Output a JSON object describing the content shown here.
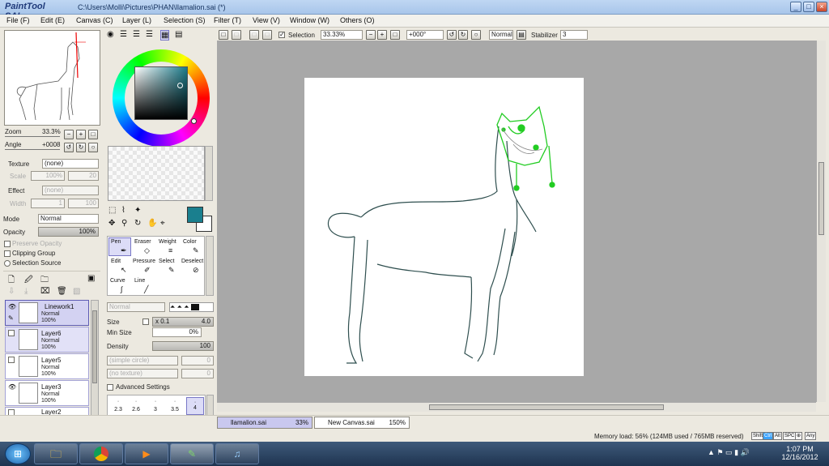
{
  "window": {
    "app_logo": "PaintTool SAI",
    "title": "C:\\Users\\Molli\\Pictures\\PHAN\\llamalion.sai (*)",
    "minimize": "_",
    "maximize": "□",
    "close": "×"
  },
  "menu": [
    {
      "label": "File (F)"
    },
    {
      "label": "Edit (E)"
    },
    {
      "label": "Canvas (C)"
    },
    {
      "label": "Layer (L)"
    },
    {
      "label": "Selection (S)"
    },
    {
      "label": "Filter (T)"
    },
    {
      "label": "View (V)"
    },
    {
      "label": "Window (W)"
    },
    {
      "label": "Others (O)"
    }
  ],
  "navigator": {
    "zoom_label": "Zoom",
    "zoom_value": "33.3%",
    "angle_label": "Angle",
    "angle_value": "+0008"
  },
  "texture": {
    "label": "Texture",
    "value": "(none)",
    "scale_label": "Scale",
    "scale_value": "100%",
    "scale_num": "20"
  },
  "effect": {
    "label": "Effect",
    "value": "(none)",
    "width_label": "Width",
    "width_value": "1",
    "width_num": "100"
  },
  "layer_props": {
    "mode_label": "Mode",
    "mode_value": "Normal",
    "opacity_label": "Opacity",
    "opacity_value": "100%",
    "opacity_level": 1.0,
    "preserve_opacity": "Preserve Opacity",
    "clipping_group": "Clipping Group",
    "selection_source": "Selection Source"
  },
  "layers": [
    {
      "name": "Linework1",
      "mode": "Normal",
      "opacity": "100%",
      "visible": true,
      "selected": true
    },
    {
      "name": "Layer6",
      "mode": "Normal",
      "opacity": "100%",
      "visible": false,
      "selected": false
    },
    {
      "name": "Layer5",
      "mode": "Normal",
      "opacity": "100%",
      "visible": false,
      "selected": false
    },
    {
      "name": "Layer3",
      "mode": "Normal",
      "opacity": "100%",
      "visible": true,
      "selected": false
    },
    {
      "name": "Layer2",
      "mode": "",
      "opacity": "",
      "visible": false,
      "selected": false
    }
  ],
  "tools": {
    "pen": "Pen",
    "eraser": "Eraser",
    "weight": "Weight",
    "color": "Color",
    "edit": "Edit",
    "pressure": "Pressure",
    "select": "Select",
    "deselect": "Deselect",
    "curve": "Curve",
    "line": "Line"
  },
  "brush": {
    "blend_mode": "Normal",
    "size_label": "Size",
    "size_mult": "x 0.1",
    "size_value": "4.0",
    "minsize_label": "Min Size",
    "minsize_value": "0%",
    "density_label": "Density",
    "density_value": "100",
    "density_level": 1.0,
    "shape": "(simple circle)",
    "shape_num": "0",
    "texture": "(no texture)",
    "texture_num": "0",
    "advanced": "Advanced Settings",
    "presets": [
      "2.3",
      "2.6",
      "3",
      "3.5",
      "4"
    ]
  },
  "canvas_toolbar": {
    "selection_label": "Selection",
    "zoom": "33.33%",
    "rotation": "+000°",
    "blend": "Normal",
    "stabilizer_label": "Stabilizer",
    "stabilizer_value": "3"
  },
  "documents": [
    {
      "name": "llamalion.sai",
      "zoom": "33%"
    },
    {
      "name": "New Canvas.sai",
      "zoom": "150%"
    }
  ],
  "status": {
    "memory": "Memory load: 56% (124MB used / 765MB reserved)",
    "keys": [
      "Shift",
      "Ctrl",
      "Alt",
      "SPC",
      "⊕",
      "Any"
    ]
  },
  "taskbar": {
    "time": "1:07 PM",
    "date": "12/16/2012"
  },
  "colors": {
    "current_fg": "#1a7f8e",
    "current_bg": "#ffffff",
    "selection_accent": "#5c5bb3",
    "lineart": "#2f4f4f",
    "guide_green": "#22cc22"
  }
}
